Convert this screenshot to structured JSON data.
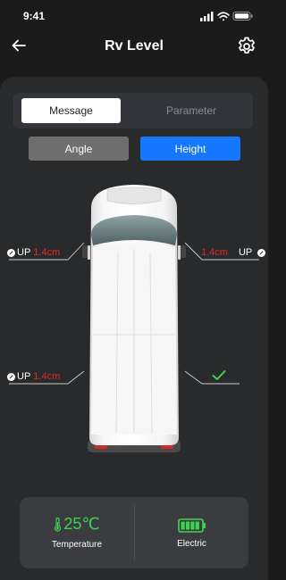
{
  "status": {
    "time": "9:41"
  },
  "header": {
    "title": "Rv Level"
  },
  "tabs": {
    "message": "Message",
    "parameter": "Parameter"
  },
  "modes": {
    "angle": "Angle",
    "height": "Height"
  },
  "wheels": {
    "front_left": {
      "direction": "UP",
      "value": "1.4cm"
    },
    "front_right": {
      "direction": "UP",
      "value": "1.4cm"
    },
    "rear_left": {
      "direction": "UP",
      "value": "1.4cm"
    },
    "rear_right": {
      "status": "level"
    }
  },
  "info": {
    "temperature_value": "25℃",
    "temperature_label": "Temperature",
    "electric_label": "Electric",
    "battery_level": 1.0
  },
  "colors": {
    "accent": "#1677ff",
    "warning": "#e02b2b",
    "ok": "#3fd44f"
  }
}
